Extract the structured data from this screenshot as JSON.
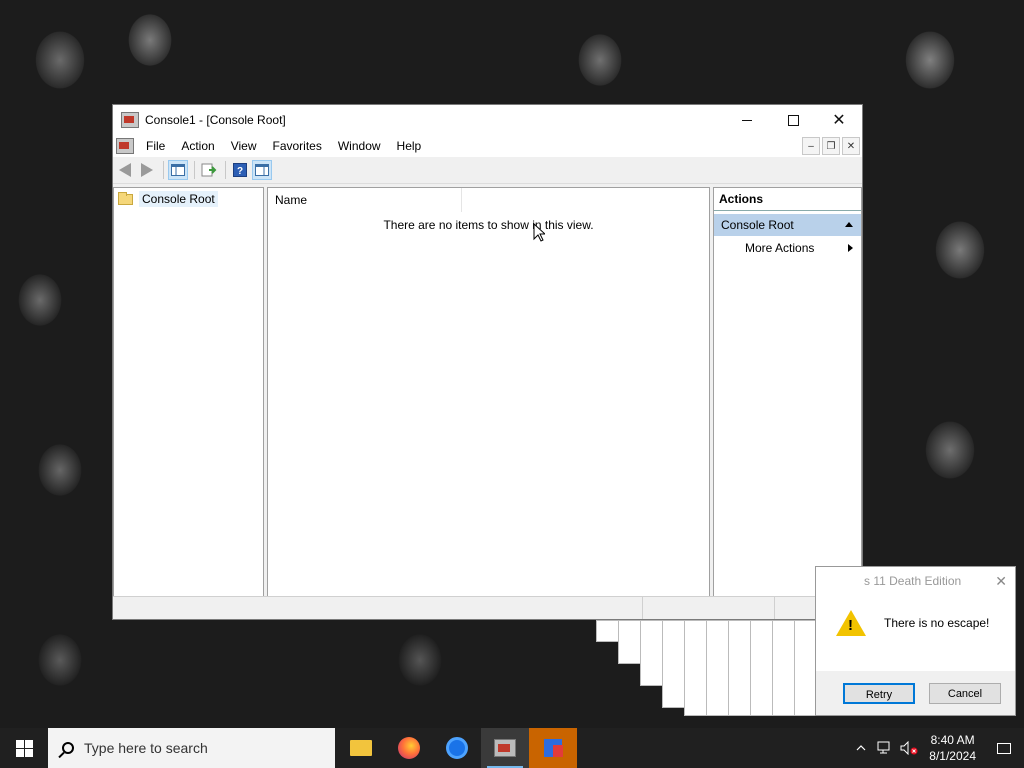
{
  "window": {
    "title": "Console1 - [Console Root]",
    "menu": [
      "File",
      "Action",
      "View",
      "Favorites",
      "Window",
      "Help"
    ],
    "controls": {
      "minimize": "minimize",
      "maximize": "maximize",
      "close": "✕"
    }
  },
  "tree": {
    "root_label": "Console Root"
  },
  "list": {
    "column_name": "Name",
    "empty_message": "There are no items to show in this view."
  },
  "actions": {
    "title": "Actions",
    "group": "Console Root",
    "items": [
      "More Actions"
    ]
  },
  "dialog": {
    "title": "s 11 Death Edition",
    "message": "There is no escape!",
    "retry": "Retry",
    "cancel": "Cancel"
  },
  "taskbar": {
    "search_placeholder": "Type here to search",
    "time": "8:40 AM",
    "date": "8/1/2024",
    "apps": [
      "file-explorer-icon",
      "firefox-icon",
      "chrome-icon",
      "mmc-icon",
      "installer-icon"
    ]
  },
  "colors": {
    "accent": "#0078d7",
    "actions_group_bg": "#b9d1ea",
    "taskbar_bg": "#202020",
    "highlight_app": "#c96400"
  }
}
